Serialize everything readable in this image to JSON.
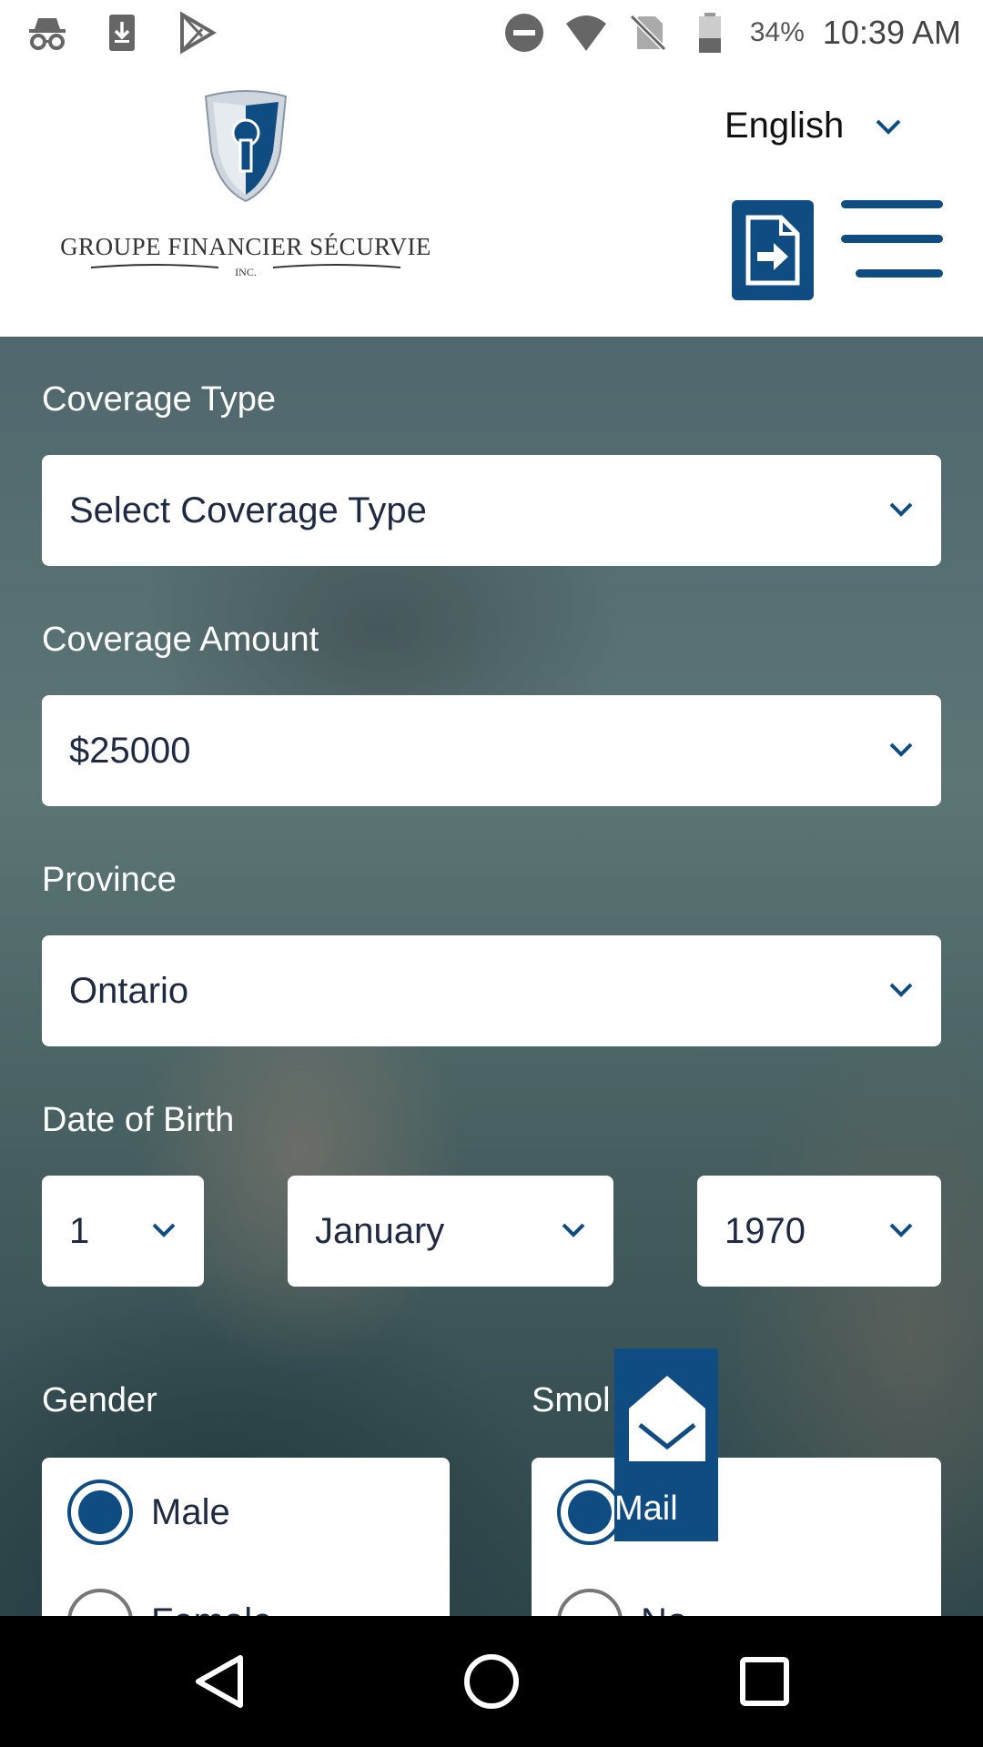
{
  "status_bar": {
    "icons_left": [
      "incognito-icon",
      "download-icon",
      "play-store-icon"
    ],
    "icons_right": [
      "do-not-disturb-icon",
      "wifi-icon",
      "no-sim-icon",
      "battery-icon"
    ],
    "battery": "34%",
    "time": "10:39 AM"
  },
  "header": {
    "logo_name": "GROUPE FINANCIER SÉCURVIE",
    "logo_suffix": "INC.",
    "language": "English"
  },
  "form": {
    "coverage_type": {
      "label": "Coverage Type",
      "value": "Select Coverage Type"
    },
    "coverage_amount": {
      "label": "Coverage Amount",
      "value": "$25000"
    },
    "province": {
      "label": "Province",
      "value": "Ontario"
    },
    "date_of_birth": {
      "label": "Date of Birth",
      "day": "1",
      "month": "January",
      "year": "1970"
    },
    "gender": {
      "label": "Gender",
      "options": [
        "Male",
        "Female"
      ],
      "selected": "Male"
    },
    "smoker": {
      "label": "Smol",
      "options": [
        "",
        "No"
      ]
    }
  },
  "mail_button": {
    "label": "Mail"
  },
  "colors": {
    "brand_blue": "#0f4c81"
  }
}
